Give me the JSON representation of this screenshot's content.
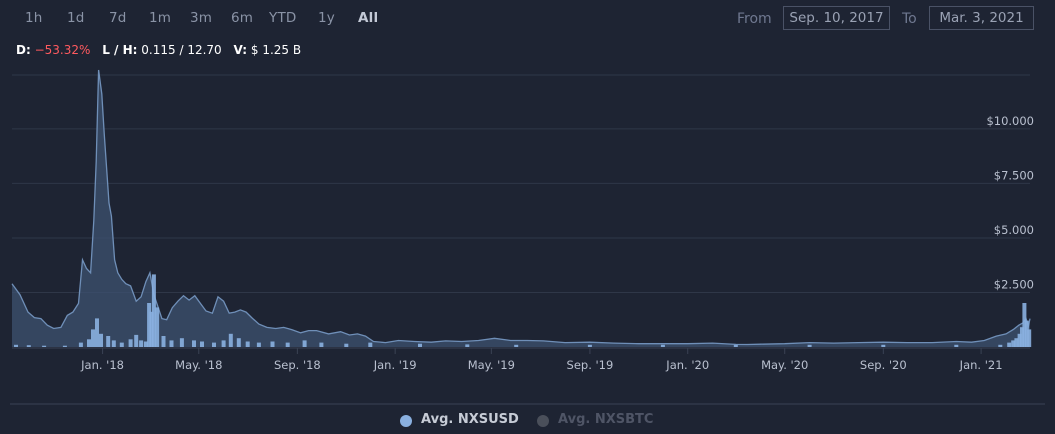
{
  "range_buttons": [
    "1h",
    "1d",
    "7d",
    "1m",
    "3m",
    "6m",
    "YTD",
    "1y",
    "All"
  ],
  "active_range": "All",
  "date_range": {
    "from_label": "From",
    "from_value": "Sep. 10, 2017",
    "to_label": "To",
    "to_value": "Mar. 3, 2021"
  },
  "stats": {
    "d_label": "D:",
    "d_value": "−53.32%",
    "lh_label": "L / H:",
    "lh_value": "0.115 / 12.70",
    "v_label": "V:",
    "v_value": "$ 1.25 B"
  },
  "colors": {
    "background": "#1e2433",
    "price_line": "#6f8fb8",
    "price_fill": "#3e5270",
    "volume_bar": "#8ab0e0",
    "grid": "#2f3748",
    "negative": "#ff5a5f"
  },
  "chart_data": {
    "type": "area",
    "x_ticks": [
      "Jan. '18",
      "May. '18",
      "Sep. '18",
      "Jan. '19",
      "May. '19",
      "Sep. '19",
      "Jan. '20",
      "May. '20",
      "Sep. '20",
      "Jan. '21"
    ],
    "y_ticks": [
      "$2.500",
      "$5.000",
      "$7.500",
      "$10.000"
    ],
    "y_tick_values": [
      2.5,
      5.0,
      7.5,
      10.0
    ],
    "ylim": [
      0,
      12.7
    ],
    "grid": true,
    "legend_position": "bottom",
    "series": [
      {
        "name": "Avg. NXSUSD",
        "visible": true,
        "x": [
          "2017-09-10",
          "2017-09-20",
          "2017-09-30",
          "2017-10-08",
          "2017-10-16",
          "2017-10-24",
          "2017-11-01",
          "2017-11-10",
          "2017-11-18",
          "2017-11-25",
          "2017-12-02",
          "2017-12-07",
          "2017-12-12",
          "2017-12-17",
          "2017-12-21",
          "2017-12-24",
          "2017-12-27",
          "2017-12-31",
          "2018-01-03",
          "2018-01-06",
          "2018-01-09",
          "2018-01-12",
          "2018-01-16",
          "2018-01-20",
          "2018-01-25",
          "2018-01-30",
          "2018-02-05",
          "2018-02-12",
          "2018-02-18",
          "2018-02-24",
          "2018-03-01",
          "2018-03-06",
          "2018-03-11",
          "2018-03-16",
          "2018-03-22",
          "2018-03-29",
          "2018-04-05",
          "2018-04-12",
          "2018-04-19",
          "2018-04-26",
          "2018-05-03",
          "2018-05-10",
          "2018-05-18",
          "2018-05-25",
          "2018-06-01",
          "2018-06-08",
          "2018-06-15",
          "2018-06-22",
          "2018-06-29",
          "2018-07-06",
          "2018-07-15",
          "2018-07-25",
          "2018-08-05",
          "2018-08-15",
          "2018-08-25",
          "2018-09-05",
          "2018-09-15",
          "2018-09-25",
          "2018-10-10",
          "2018-10-25",
          "2018-11-05",
          "2018-11-15",
          "2018-11-25",
          "2018-12-05",
          "2018-12-20",
          "2019-01-05",
          "2019-01-25",
          "2019-02-15",
          "2019-03-05",
          "2019-03-25",
          "2019-04-15",
          "2019-05-05",
          "2019-05-25",
          "2019-06-15",
          "2019-07-05",
          "2019-08-01",
          "2019-09-01",
          "2019-10-01",
          "2019-11-01",
          "2019-12-01",
          "2020-01-01",
          "2020-02-01",
          "2020-03-01",
          "2020-03-15",
          "2020-04-01",
          "2020-05-01",
          "2020-06-01",
          "2020-07-01",
          "2020-08-01",
          "2020-09-01",
          "2020-10-01",
          "2020-11-01",
          "2020-12-01",
          "2020-12-20",
          "2021-01-05",
          "2021-01-20",
          "2021-02-01",
          "2021-02-10",
          "2021-02-17",
          "2021-02-22",
          "2021-02-26",
          "2021-03-01",
          "2021-03-03"
        ],
        "y": [
          2.9,
          2.4,
          1.6,
          1.35,
          1.3,
          1.0,
          0.85,
          0.9,
          1.45,
          1.6,
          2.0,
          4.0,
          3.6,
          3.4,
          5.8,
          8.5,
          12.7,
          11.6,
          9.8,
          8.2,
          6.6,
          6.0,
          4.0,
          3.4,
          3.1,
          2.9,
          2.8,
          2.1,
          2.3,
          3.0,
          3.4,
          2.4,
          1.85,
          1.3,
          1.25,
          1.8,
          2.1,
          2.35,
          2.15,
          2.35,
          2.0,
          1.65,
          1.55,
          2.3,
          2.1,
          1.55,
          1.6,
          1.7,
          1.6,
          1.35,
          1.05,
          0.9,
          0.85,
          0.9,
          0.8,
          0.65,
          0.75,
          0.75,
          0.6,
          0.7,
          0.55,
          0.6,
          0.5,
          0.25,
          0.2,
          0.3,
          0.25,
          0.22,
          0.28,
          0.25,
          0.3,
          0.4,
          0.3,
          0.3,
          0.28,
          0.2,
          0.22,
          0.18,
          0.15,
          0.15,
          0.15,
          0.18,
          0.12,
          0.115,
          0.13,
          0.15,
          0.2,
          0.18,
          0.2,
          0.22,
          0.2,
          0.2,
          0.25,
          0.22,
          0.3,
          0.5,
          0.6,
          0.8,
          1.0,
          1.1,
          1.3,
          0.95,
          1.3
        ]
      },
      {
        "name": "Avg. NXSBTC",
        "visible": false
      }
    ],
    "volume_bars": {
      "x": [
        "2017-09-15",
        "2017-10-01",
        "2017-10-20",
        "2017-11-15",
        "2017-12-05",
        "2017-12-15",
        "2017-12-20",
        "2017-12-25",
        "2017-12-30",
        "2018-01-08",
        "2018-01-15",
        "2018-01-25",
        "2018-02-05",
        "2018-02-12",
        "2018-02-18",
        "2018-02-24",
        "2018-02-28",
        "2018-03-03",
        "2018-03-06",
        "2018-03-10",
        "2018-03-18",
        "2018-03-28",
        "2018-04-10",
        "2018-04-25",
        "2018-05-05",
        "2018-05-20",
        "2018-06-01",
        "2018-06-10",
        "2018-06-20",
        "2018-07-01",
        "2018-07-15",
        "2018-08-01",
        "2018-08-20",
        "2018-09-10",
        "2018-10-01",
        "2018-11-01",
        "2018-12-01",
        "2019-02-01",
        "2019-04-01",
        "2019-06-01",
        "2019-09-01",
        "2019-12-01",
        "2020-03-01",
        "2020-06-01",
        "2020-09-01",
        "2020-12-01",
        "2021-01-25",
        "2021-02-05",
        "2021-02-10",
        "2021-02-14",
        "2021-02-18",
        "2021-02-21",
        "2021-02-24",
        "2021-02-27",
        "2021-03-02"
      ],
      "values": [
        0.1,
        0.08,
        0.06,
        0.06,
        0.2,
        0.35,
        0.8,
        1.3,
        0.6,
        0.5,
        0.3,
        0.2,
        0.35,
        0.55,
        0.3,
        0.25,
        2.0,
        1.6,
        3.3,
        1.8,
        0.5,
        0.3,
        0.4,
        0.3,
        0.25,
        0.2,
        0.3,
        0.6,
        0.4,
        0.25,
        0.2,
        0.25,
        0.2,
        0.3,
        0.2,
        0.15,
        0.2,
        0.15,
        0.12,
        0.1,
        0.1,
        0.1,
        0.1,
        0.1,
        0.1,
        0.1,
        0.1,
        0.2,
        0.3,
        0.4,
        0.6,
        0.9,
        2.0,
        1.2,
        0.8
      ]
    }
  },
  "legend": [
    {
      "label": "Avg. NXSUSD",
      "active": true,
      "color": "#8ab0e0"
    },
    {
      "label": "Avg. NXSBTC",
      "active": false,
      "color": "#4a4f5a"
    }
  ]
}
